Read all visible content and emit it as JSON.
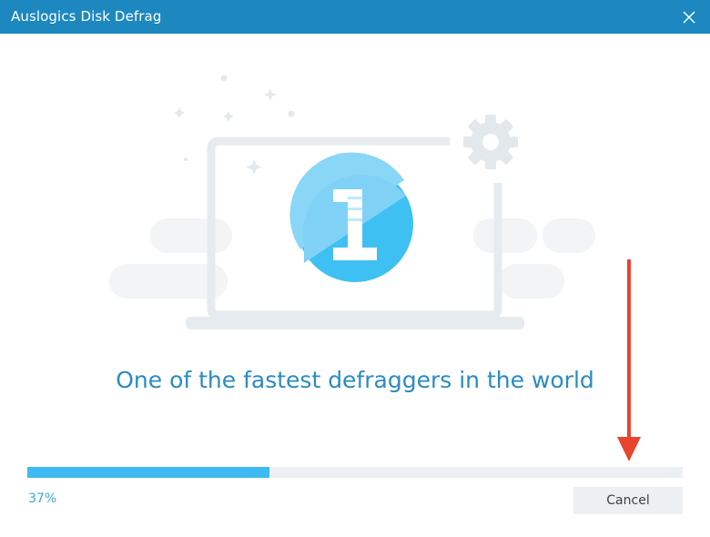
{
  "window": {
    "title": "Auslogics Disk Defrag",
    "close_icon": "close-icon",
    "titlebar_color": "#1c88bf"
  },
  "main": {
    "tagline": "One of the fastest defraggers in the world",
    "illustration_icons": [
      "laptop-icon",
      "gear-icon",
      "number-one-badge-icon",
      "sparkle-icon"
    ]
  },
  "progress": {
    "value": 0.37,
    "label": "37%",
    "fill_color": "#3dbbf0",
    "track_color": "#edf0f3"
  },
  "footer": {
    "cancel_label": "Cancel"
  },
  "annotation": {
    "icon": "red-arrow-down-icon",
    "color": "#e8442e"
  }
}
